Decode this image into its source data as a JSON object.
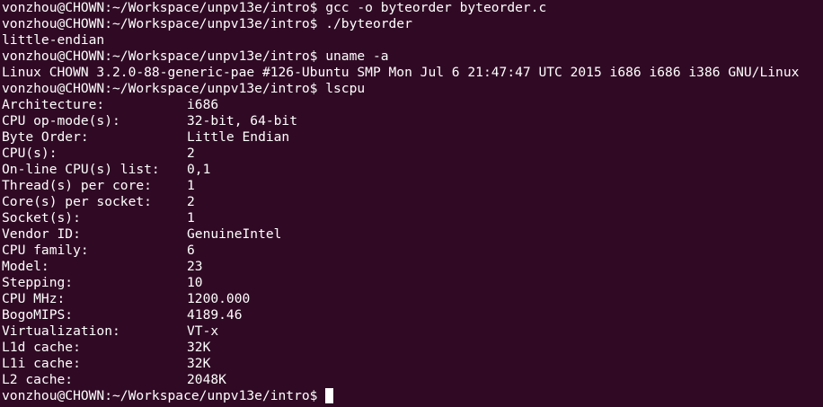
{
  "terminal": {
    "background": "#300a24",
    "foreground": "#ffffff",
    "prompt": "vonzhou@CHOWN:~/Workspace/unpv13e/intro$ ",
    "lines_before": [
      "vonzhou@CHOWN:~/Workspace/unpv13e/intro$ gcc -o byteorder byteorder.c",
      "vonzhou@CHOWN:~/Workspace/unpv13e/intro$ ./byteorder",
      "little-endian",
      "vonzhou@CHOWN:~/Workspace/unpv13e/intro$ uname -a",
      "Linux CHOWN 3.2.0-88-generic-pae #126-Ubuntu SMP Mon Jul 6 21:47:47 UTC 2015 i686 i686 i386 GNU/Linux",
      "vonzhou@CHOWN:~/Workspace/unpv13e/intro$ lscpu"
    ],
    "lscpu": [
      {
        "key": "Architecture:",
        "value": "i686"
      },
      {
        "key": "CPU op-mode(s):",
        "value": "32-bit, 64-bit"
      },
      {
        "key": "Byte Order:",
        "value": "Little Endian"
      },
      {
        "key": "CPU(s):",
        "value": "2"
      },
      {
        "key": "On-line CPU(s) list:",
        "value": "0,1"
      },
      {
        "key": "Thread(s) per core:",
        "value": "1"
      },
      {
        "key": "Core(s) per socket:",
        "value": "2"
      },
      {
        "key": "Socket(s):",
        "value": "1"
      },
      {
        "key": "Vendor ID:",
        "value": "GenuineIntel"
      },
      {
        "key": "CPU family:",
        "value": "6"
      },
      {
        "key": "Model:",
        "value": "23"
      },
      {
        "key": "Stepping:",
        "value": "10"
      },
      {
        "key": "CPU MHz:",
        "value": "1200.000"
      },
      {
        "key": "BogoMIPS:",
        "value": "4189.46"
      },
      {
        "key": "Virtualization:",
        "value": "VT-x"
      },
      {
        "key": "L1d cache:",
        "value": "32K"
      },
      {
        "key": "L1i cache:",
        "value": "32K"
      },
      {
        "key": "L2 cache:",
        "value": "2048K"
      }
    ]
  }
}
